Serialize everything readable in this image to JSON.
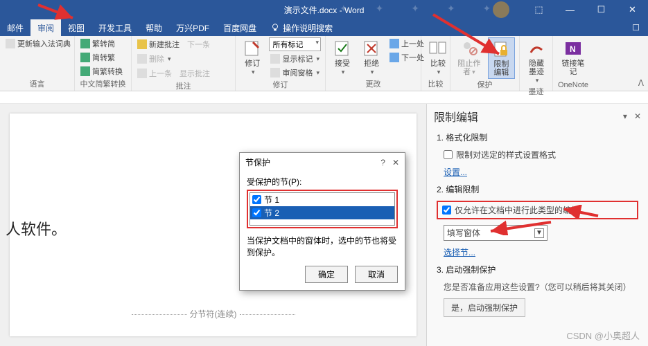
{
  "titlebar": {
    "title": "演示文件.docx - Word"
  },
  "tabs": {
    "t0": "邮件",
    "t1": "审阅",
    "t2": "视图",
    "t3": "开发工具",
    "t4": "帮助",
    "t5": "万兴PDF",
    "t6": "百度网盘",
    "tellme": "操作说明搜索"
  },
  "ribbon": {
    "g_lang": {
      "label": "语言",
      "update_ime": "更新输入法词典"
    },
    "g_cn": {
      "label": "中文简繁转换",
      "s2t": "繁转简",
      "t2s": "简转繁",
      "conv": "简繁转换"
    },
    "g_comment": {
      "label": "批注",
      "new": "新建批注",
      "del": "删除",
      "prev": "上一条",
      "next": "下一条",
      "show": "显示批注"
    },
    "g_track": {
      "label": "修订",
      "track": "修订",
      "showmark": "显示标记",
      "reviewpane": "审阅窗格",
      "dd": "所有标记"
    },
    "g_changes": {
      "label": "更改",
      "accept": "接受",
      "reject": "拒绝",
      "prev": "上一处",
      "next": "下一处"
    },
    "g_compare": {
      "label": "比较",
      "btn": "比较"
    },
    "g_protect": {
      "label": "保护",
      "block": "阻止作者",
      "restrict": "限制编辑"
    },
    "g_ink": {
      "label": "墨迹",
      "btn": "隐藏墨迹"
    },
    "g_onenote": {
      "label": "OneNote",
      "btn": "链接笔记"
    }
  },
  "doc": {
    "visible_text": "人软件。",
    "section_break": "分节符(连续)"
  },
  "dialog": {
    "title": "节保护",
    "label": "受保护的节(P):",
    "items": [
      {
        "label": "节 1",
        "checked": true,
        "selected": false
      },
      {
        "label": "节 2",
        "checked": true,
        "selected": true
      }
    ],
    "note": "当保护文档中的窗体时，选中的节也将受到保护。",
    "ok": "确定",
    "cancel": "取消"
  },
  "pane": {
    "title": "限制编辑",
    "s1": "1. 格式化限制",
    "s1_cb": "限制对选定的样式设置格式",
    "s1_link": "设置...",
    "s2": "2. 编辑限制",
    "s2_cb": "仅允许在文档中进行此类型的编辑:",
    "s2_combo": "填写窗体",
    "s2_link": "选择节...",
    "s3": "3. 启动强制保护",
    "s3_hint": "您是否准备应用这些设置?（您可以稍后将其关闭）",
    "s3_btn": "是，启动强制保护"
  },
  "watermark": "CSDN @小奥超人"
}
